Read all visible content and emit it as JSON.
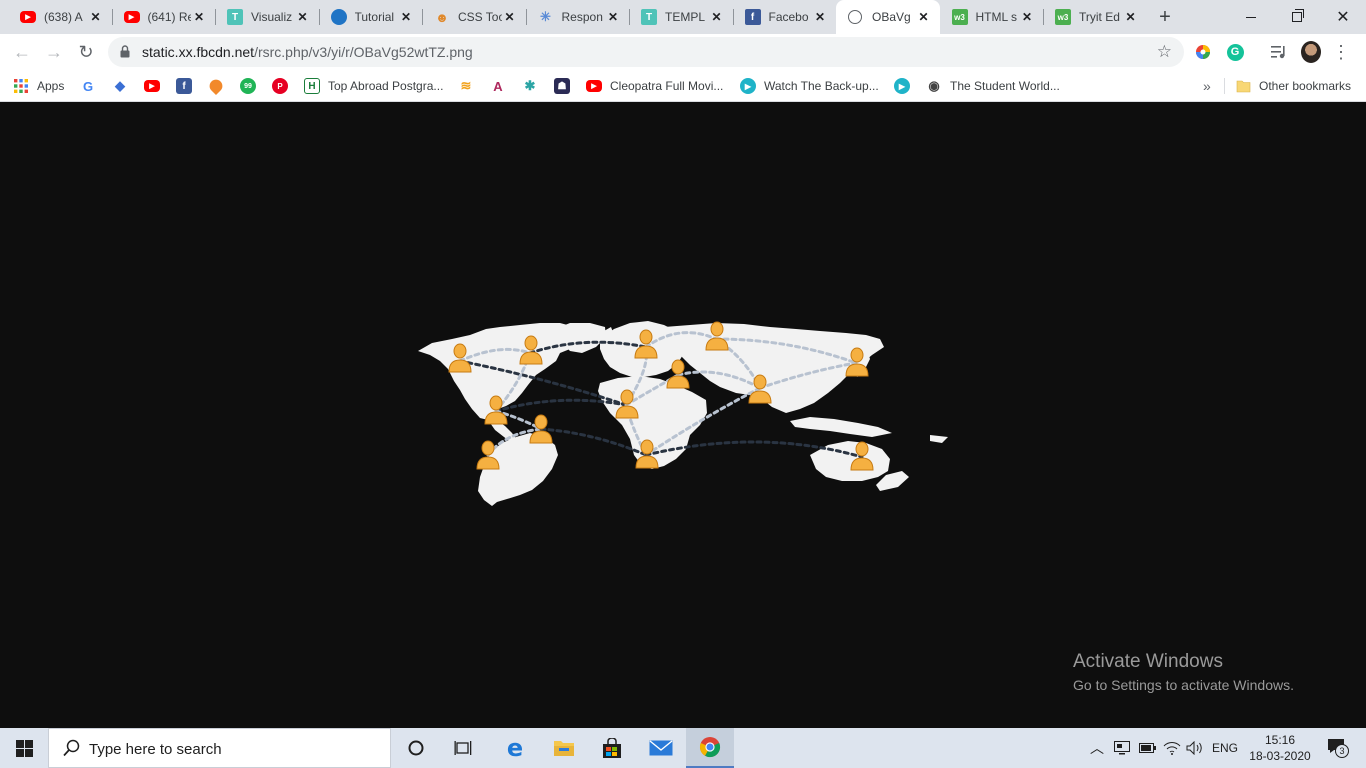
{
  "browser": {
    "tabs": [
      {
        "title": "(638) A",
        "favicon": "youtube-icon",
        "color": "#ff0000",
        "active": false
      },
      {
        "title": "(641) Re",
        "favicon": "youtube-icon",
        "color": "#ff0000",
        "active": false
      },
      {
        "title": "Visualiz",
        "favicon": "t-icon",
        "color": "#4fc3b8",
        "active": false
      },
      {
        "title": "Tutorial",
        "favicon": "drop-icon",
        "color": "#1f74c5",
        "active": false
      },
      {
        "title": "CSS Too",
        "favicon": "tiger-icon",
        "color": "#e0892c",
        "active": false
      },
      {
        "title": "Respon",
        "favicon": "spider-icon",
        "color": "#5a8bd6",
        "active": false
      },
      {
        "title": "TEMPL",
        "favicon": "t-icon",
        "color": "#4fc3b8",
        "active": false
      },
      {
        "title": "Facebo",
        "favicon": "facebook-icon",
        "color": "#3b5998",
        "active": false
      },
      {
        "title": "OBaVg",
        "favicon": "globe-icon",
        "color": "#5f6368",
        "active": true
      },
      {
        "title": "HTML s",
        "favicon": "w3-icon",
        "color": "#4caf50",
        "active": false
      },
      {
        "title": "Tryit Ed",
        "favicon": "w3-icon",
        "color": "#4caf50",
        "active": false
      }
    ],
    "address": {
      "domain": "static.xx.fbcdn.net",
      "path": "/rsrc.php/v3/yi/r/OBaVg52wtTZ.png"
    },
    "bookmarks": {
      "apps_label": "Apps",
      "items": [
        {
          "label": "",
          "icon": "google-icon",
          "color": "#4285f4"
        },
        {
          "label": "",
          "icon": "graduation-cap-icon",
          "color": "#3b6fd4"
        },
        {
          "label": "",
          "icon": "youtube-icon",
          "color": "#ff0000"
        },
        {
          "label": "",
          "icon": "facebook-icon",
          "color": "#3b5998"
        },
        {
          "label": "",
          "icon": "pin-icon",
          "color": "#f2892b"
        },
        {
          "label": "",
          "icon": "99-icon",
          "color": "#20b456"
        },
        {
          "label": "",
          "icon": "pinterest-icon",
          "color": "#e60023"
        },
        {
          "label": "Top Abroad Postgra...",
          "icon": "h-icon",
          "color": "#1a7d3a"
        },
        {
          "label": "",
          "icon": "stripes-icon",
          "color": "#f2a21b"
        },
        {
          "label": "",
          "icon": "axis-icon",
          "color": "#ae285d"
        },
        {
          "label": "",
          "icon": "bug-icon",
          "color": "#2ca5a5"
        },
        {
          "label": "",
          "icon": "mask-icon",
          "color": "#2b2b55"
        },
        {
          "label": "Cleopatra Full Movi...",
          "icon": "youtube-icon",
          "color": "#ff0000"
        },
        {
          "label": "Watch The Back-up...",
          "icon": "play-icon",
          "color": "#1fb3c8"
        },
        {
          "label": "",
          "icon": "play-icon",
          "color": "#1fb3c8"
        },
        {
          "label": "The Student World...",
          "icon": "student-icon",
          "color": "#444444"
        }
      ],
      "overflow": "»",
      "other_label": "Other bookmarks"
    }
  },
  "watermark": {
    "title": "Activate Windows",
    "subtitle": "Go to Settings to activate Windows."
  },
  "taskbar": {
    "search_placeholder": "Type here to search",
    "lang": "ENG",
    "time": "15:16",
    "date": "18-03-2020",
    "notification_count": "3"
  },
  "colors": {
    "map_land": "#f2f2f2",
    "map_background": "#0e0e0e",
    "person_marker": "#f5b041",
    "connection_light": "#b8c2d0",
    "connection_dark": "#2a3442"
  }
}
